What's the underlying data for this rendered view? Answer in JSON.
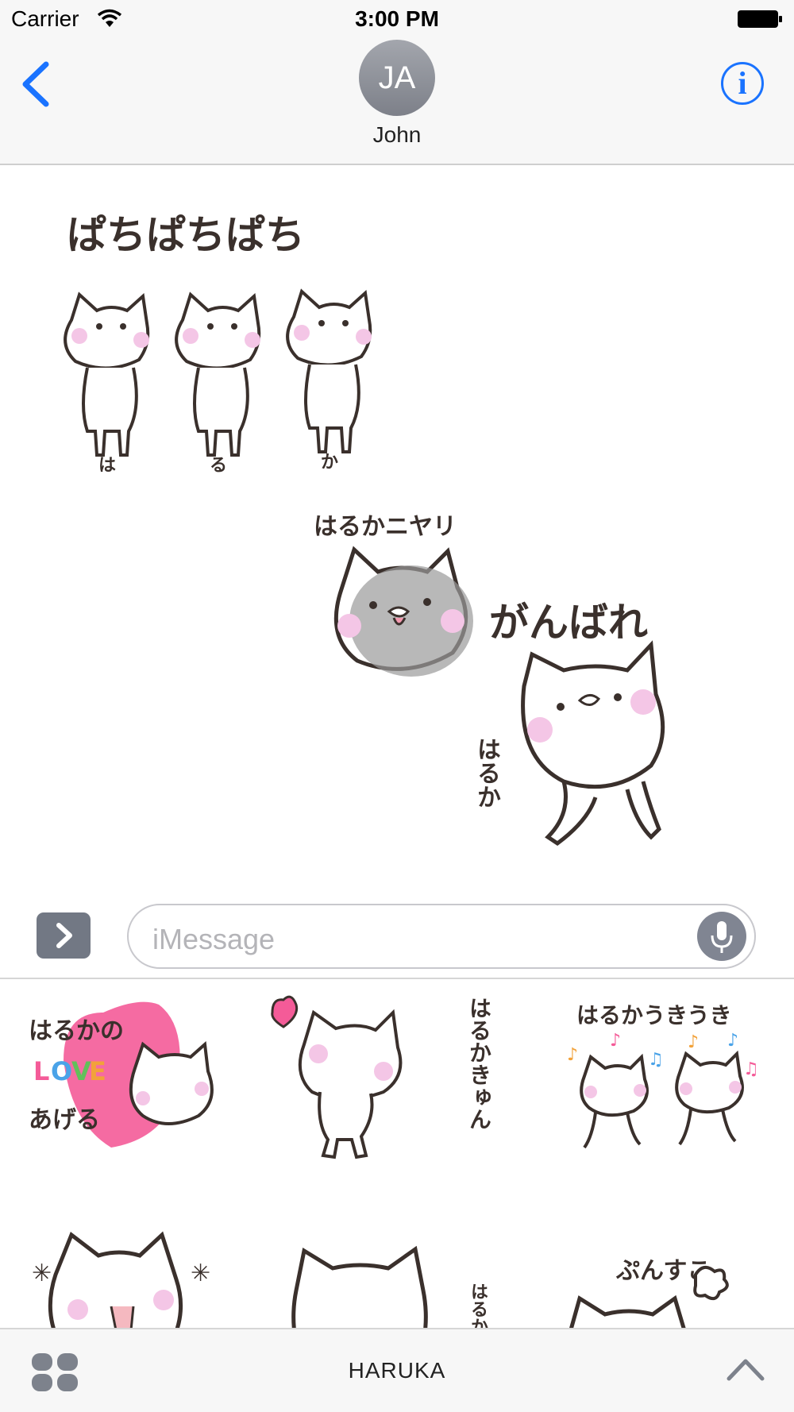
{
  "status_bar": {
    "carrier": "Carrier",
    "time": "3:00 PM"
  },
  "header": {
    "avatar_initials": "JA",
    "contact_name": "John",
    "info_label": "i"
  },
  "conversation": {
    "stickers": [
      {
        "id": "pachipachi",
        "text": "ぱちぱちぱち",
        "sub": [
          "は",
          "る",
          "か"
        ]
      },
      {
        "id": "niyari",
        "text": "はるかニヤリ"
      },
      {
        "id": "ganbare",
        "text": "がんばれ",
        "sub": "はるか"
      }
    ]
  },
  "compose": {
    "placeholder": "iMessage"
  },
  "drawer": {
    "row1": [
      {
        "line1": "はるかの",
        "love": [
          "L",
          "O",
          "V",
          "E"
        ],
        "line3": "あげる"
      },
      {
        "text": "はるかきゅん"
      },
      {
        "text": "はるかうきうき"
      }
    ],
    "row2": [
      {
        "text": ""
      },
      {
        "text": "はるか"
      },
      {
        "text": "ぷんすこ"
      }
    ]
  },
  "bottom_bar": {
    "pack_name": "HARUKA"
  },
  "colors": {
    "accent": "#1a73ff",
    "cheek": "#f4c6e6",
    "heart": "#f45b98",
    "ink": "#3a302c"
  }
}
